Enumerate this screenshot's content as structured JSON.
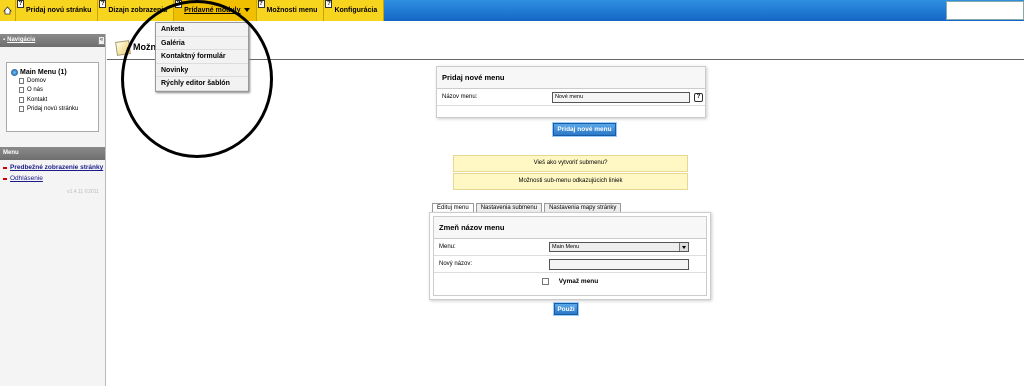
{
  "top_tabs": [
    {
      "label": "Pridaj novú stránku"
    },
    {
      "label": "Dizajn zobrazenia"
    },
    {
      "label": "Prídavné moduly"
    },
    {
      "label": "Možnosti menu"
    },
    {
      "label": "Konfigurácia"
    }
  ],
  "help_mark": "?",
  "dropdown_items": [
    "Anketa",
    "Galéria",
    "Kontaktný formulár",
    "Novinky",
    "Rýchly editor šablón"
  ],
  "sidebar": {
    "head": "Navigácia",
    "collapse": "«",
    "tree_root": "Main Menu (1)",
    "tree_items": [
      "Domov",
      "O nás",
      "Kontakt",
      "Pridaj novú stránku"
    ],
    "menu_head": "Menu",
    "links": [
      "Predbežné zobrazenie stránky",
      "Odhlásenie"
    ],
    "version": "v1.4.11 ©2011"
  },
  "content": {
    "title": "Možnosti menu"
  },
  "add_panel": {
    "title": "Pridaj nové menu",
    "name_label": "Názov menu:",
    "name_value": "Nové menu",
    "button": "Pridaj nové menu"
  },
  "notes": [
    "Vieš ako vytvoriť submenu?",
    "Možnosti sub-menu odkazujúcich liniek"
  ],
  "sub_tabs": [
    "Edituj menu",
    "Nastavenia submenu",
    "Nastavenia mapy stránky"
  ],
  "edit_panel": {
    "title": "Zmeň názov menu",
    "menu_label": "Menu:",
    "menu_value": "Main Menu",
    "new_name_label": "Nový názov:",
    "new_name_value": "",
    "delete_label": "Vymaž menu",
    "button": "Použi"
  }
}
